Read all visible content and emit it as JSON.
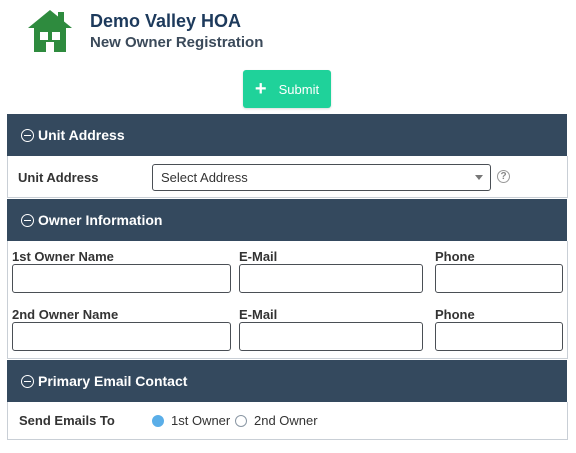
{
  "header": {
    "title": "Demo Valley HOA",
    "subtitle": "New Owner Registration"
  },
  "toolbar": {
    "submit_label": "Submit",
    "submit_color": "#1fd29a"
  },
  "colors": {
    "section_header": "#34495e",
    "radio_selected": "#5aaee8"
  },
  "unit_address": {
    "section_title": "Unit Address",
    "label": "Unit Address",
    "select_value": "Select Address",
    "help_glyph": "?"
  },
  "owner_info": {
    "section_title": "Owner Information",
    "owner1": {
      "name_label": "1st Owner Name",
      "email_label": "E-Mail",
      "phone_label": "Phone",
      "name_value": "",
      "email_value": "",
      "phone_value": ""
    },
    "owner2": {
      "name_label": "2nd Owner Name",
      "email_label": "E-Mail",
      "phone_label": "Phone",
      "name_value": "",
      "email_value": "",
      "phone_value": ""
    }
  },
  "email_contact": {
    "section_title": "Primary Email Contact",
    "label": "Send Emails To",
    "options": [
      "1st Owner",
      "2nd Owner"
    ],
    "selected": "1st Owner"
  }
}
